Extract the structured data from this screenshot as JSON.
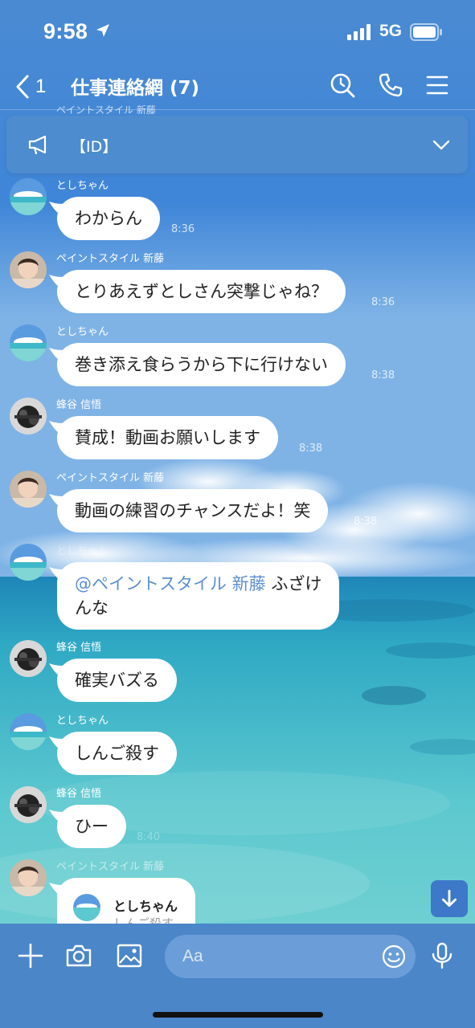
{
  "status_bar": {
    "time": "9:58",
    "network": "5G"
  },
  "header": {
    "back_count": "1",
    "title": "仕事連絡網 (7)"
  },
  "announcement": {
    "text": "【ID】"
  },
  "peek_sender": "ペイントスタイル 新藤",
  "messages": [
    {
      "sender": "としちゃん",
      "text": "わからん",
      "time": "8:36"
    },
    {
      "sender": "ペイントスタイル 新藤",
      "text": "とりあえずとしさん突撃じゃね？",
      "time": "8:36"
    },
    {
      "sender": "としちゃん",
      "text": "巻き添え食らうから下に行けない",
      "time": "8:38"
    },
    {
      "sender": "蜂谷 信悟",
      "text": "賛成！動画お願いします",
      "time": "8:38"
    },
    {
      "sender": "ペイントスタイル 新藤",
      "text": "動画の練習のチャンスだよ！笑",
      "time": "8:38"
    },
    {
      "sender": "としちゃん",
      "mention": "@ペイントスタイル 新藤",
      "text_line1": "ふざけ",
      "text_line2": "んな"
    },
    {
      "sender": "蜂谷 信悟",
      "text": "確実バズる"
    },
    {
      "sender": "としちゃん",
      "text": "しんご殺す"
    },
    {
      "sender": "蜂谷 信悟",
      "text": "ひー",
      "time": "8:40"
    },
    {
      "sender": "ペイントスタイル 新藤",
      "reply_name": "としちゃん",
      "reply_text": "しんご殺す"
    }
  ],
  "input": {
    "placeholder": "Aa"
  },
  "icons": {
    "location": "location-arrow-icon",
    "search": "search-icon",
    "call": "phone-icon",
    "menu": "menu-icon",
    "announcement": "megaphone-icon",
    "add": "plus-icon",
    "camera": "camera-icon",
    "image": "image-icon",
    "emoji": "emoji-icon",
    "mic": "microphone-icon",
    "scroll": "arrow-down-icon"
  },
  "colors": {
    "header_bg": "#4a8ad2",
    "bubble": "#ffffff",
    "mention": "#5b8fd0",
    "input_bar": "#4b86c9"
  }
}
